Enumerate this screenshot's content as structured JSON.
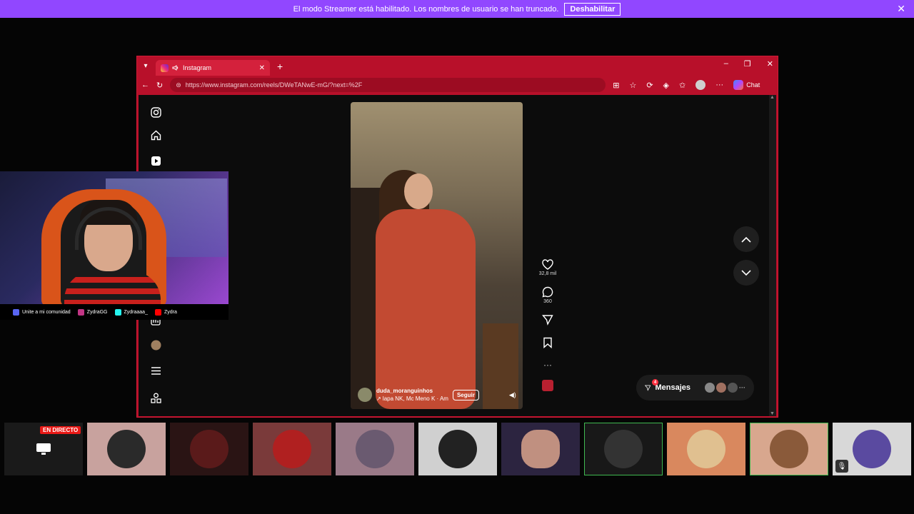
{
  "banner": {
    "message": "El modo Streamer está habilitado. Los nombres de usuario se han truncado.",
    "disable_label": "Deshabilitar",
    "close": "✕"
  },
  "browser": {
    "tab_title": "Instagram",
    "new_tab": "+",
    "url": "https://www.instagram.com/reels/DWeTANwE-mG/?next=%2F",
    "chat_label": "Chat"
  },
  "reel": {
    "likes": "32,8 mil",
    "comments": "360",
    "author": "duda_moranguinhos",
    "audio": "↗ lapa NK, Mc Meno K · Am",
    "follow_label": "Seguir"
  },
  "messages": {
    "label": "Mensajes",
    "badge": "4",
    "more": "···"
  },
  "socials": [
    {
      "label": "Unite a mi comunidad",
      "color": "#5865f2"
    },
    {
      "label": "ZydraGG",
      "color": "#c13584"
    },
    {
      "label": "Zydraaaa_",
      "color": "#25f4ee"
    },
    {
      "label": "Zydra",
      "color": "#ff0000"
    }
  ],
  "participants": {
    "live_label": "EN DIRECTO"
  },
  "colors": {
    "streamer_banner": "#9147ff",
    "browser_frame": "#b8102a",
    "live_badge": "#e91916",
    "selected_border": "#3fb950"
  }
}
